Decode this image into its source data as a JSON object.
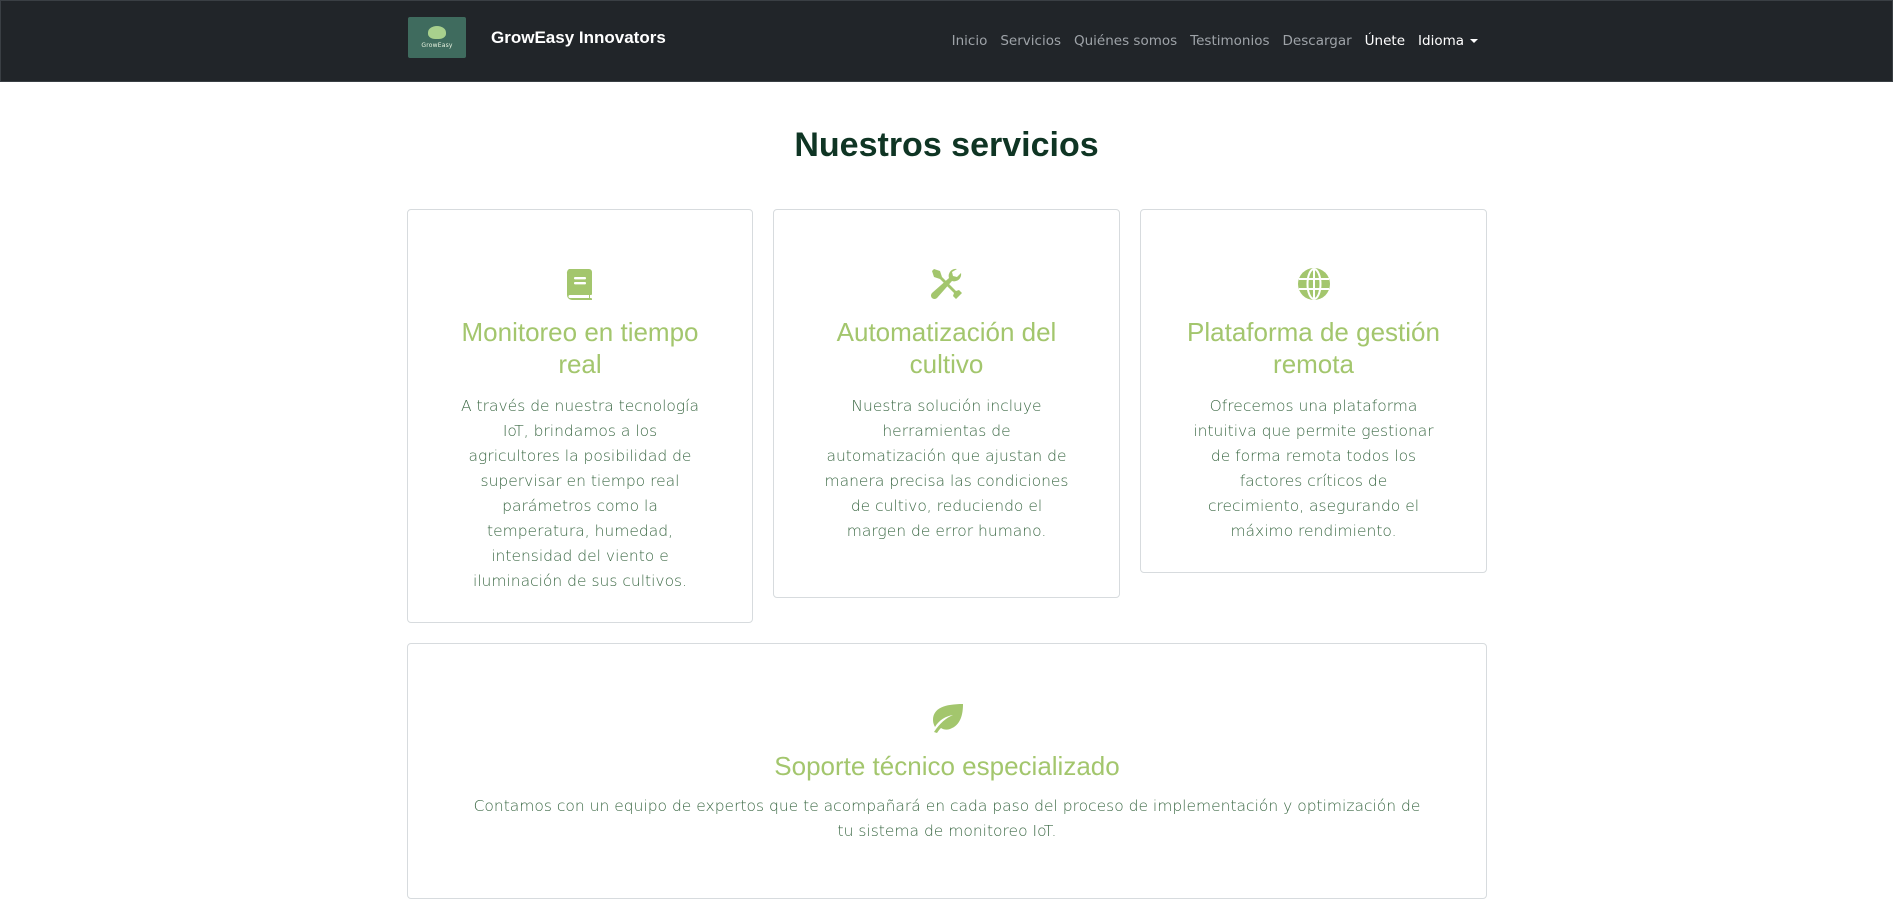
{
  "brand": {
    "name": "GrowEasy Innovators",
    "logo_text": "GrowEasy"
  },
  "nav": {
    "items": [
      "Inicio",
      "Servicios",
      "Quiénes somos",
      "Testimonios",
      "Descargar",
      "Únete",
      "Idioma"
    ]
  },
  "services": {
    "heading": "Nuestros servicios",
    "cards": [
      {
        "icon": "book-icon",
        "title": "Monitoreo en tiempo real",
        "text": "A través de nuestra tecnología IoT, brindamos a los agricultores la posibilidad de supervisar en tiempo real parámetros como la temperatura, humedad, intensidad del viento e iluminación de sus cultivos."
      },
      {
        "icon": "tools-icon",
        "title": "Automatización del cultivo",
        "text": "Nuestra solución incluye herramientas de automatización que ajustan de manera precisa las condiciones de cultivo, reduciendo el margen de error humano."
      },
      {
        "icon": "globe-icon",
        "title": "Plataforma de gestión remota",
        "text": "Ofrecemos una plataforma intuitiva que permite gestionar de forma remota todos los factores críticos de crecimiento, asegurando el máximo rendimiento."
      },
      {
        "icon": "leaf-icon",
        "title": "Soporte técnico especializado",
        "text": "Contamos con un equipo de expertos que te acompañará en cada paso del proceso de implementación y optimización de tu sistema de monitoreo IoT."
      }
    ]
  },
  "colors": {
    "navbar": "#212529",
    "heading": "#0f3524",
    "accent": "#a3c66d",
    "body_text": "#3d6a46"
  }
}
